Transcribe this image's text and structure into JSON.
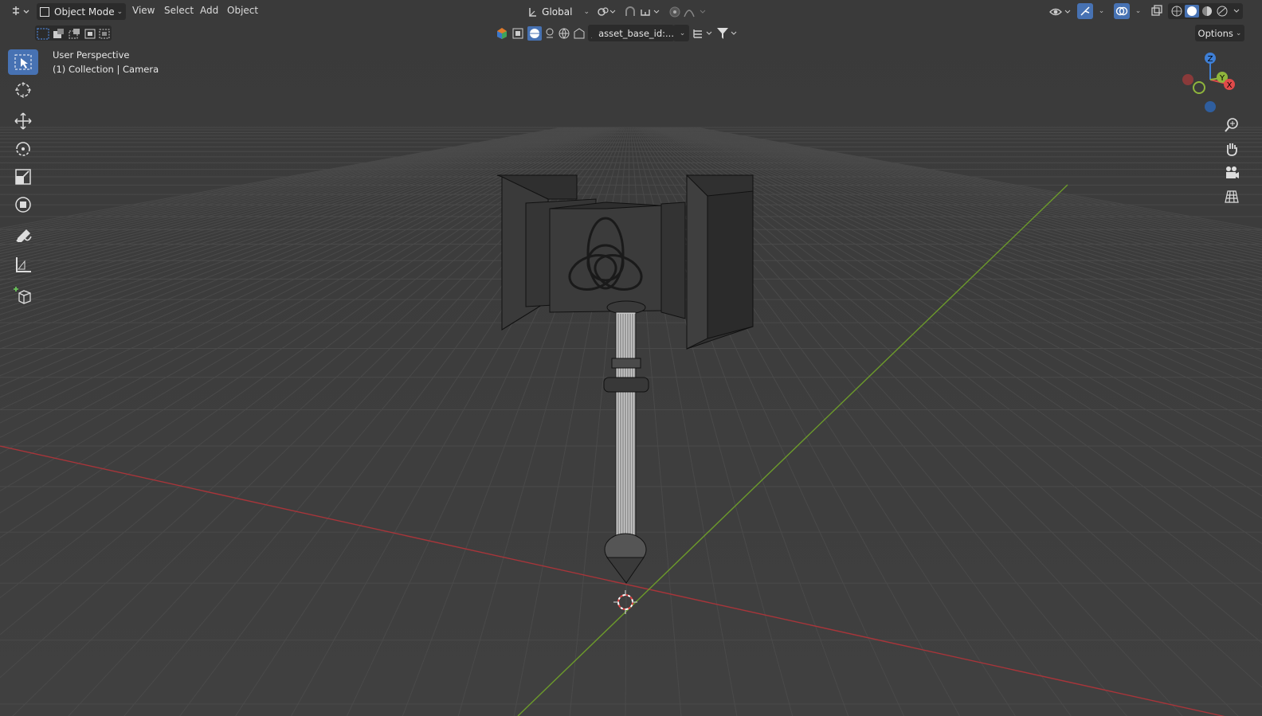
{
  "header": {
    "mode_label": "Object Mode",
    "menus": [
      "View",
      "Select",
      "Add",
      "Object"
    ],
    "transform_orientation": "Global",
    "options_label": "Options"
  },
  "outliner_filter": {
    "search_text": "asset_base_id:..."
  },
  "viewport": {
    "view_name": "User Perspective",
    "collection_label": "(1) Collection | Camera"
  },
  "gizmo": {
    "x_label": "X",
    "y_label": "Y",
    "z_label": "Z",
    "colors": {
      "x": "#e04a4a",
      "y": "#8fb53c",
      "z": "#3e7fd6"
    }
  },
  "icons": {
    "editor_type": "view3d-icon",
    "tools": [
      "select-box-icon",
      "cursor-icon",
      "move-icon",
      "rotate-icon",
      "scale-icon",
      "transform-icon",
      "annotate-icon",
      "measure-icon",
      "add-cube-icon"
    ],
    "nav": [
      "zoom-icon",
      "pan-hand-icon",
      "camera-view-icon",
      "ortho-grid-icon"
    ]
  },
  "colors": {
    "background": "#3d3d3d",
    "grid": "#474747",
    "x_axis": "#a8353a",
    "y_axis": "#6c9a2b",
    "active_tool": "#4772b3"
  }
}
